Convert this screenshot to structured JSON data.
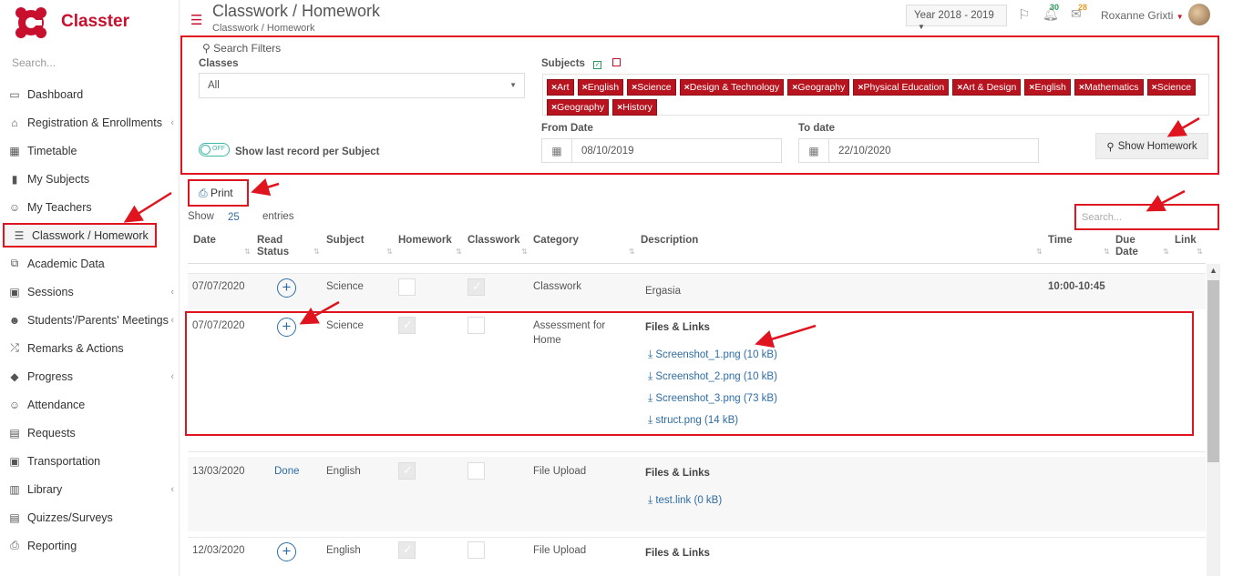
{
  "app": {
    "name": "Classter"
  },
  "sidebar": {
    "search_placeholder": "Search...",
    "items": [
      {
        "label": "Dashboard",
        "icon": "monitor-icon"
      },
      {
        "label": "Registration & Enrollments",
        "icon": "institution-icon",
        "chevron": true
      },
      {
        "label": "Timetable",
        "icon": "calendar-icon"
      },
      {
        "label": "My Subjects",
        "icon": "book-icon"
      },
      {
        "label": "My Teachers",
        "icon": "users-icon"
      },
      {
        "label": "Classwork / Homework",
        "icon": "list-icon",
        "active": true
      },
      {
        "label": "Academic Data",
        "icon": "chart-icon"
      },
      {
        "label": "Sessions",
        "icon": "sessions-icon",
        "chevron": true
      },
      {
        "label": "Students'/Parents' Meetings",
        "icon": "meeting-icon",
        "chevron": true
      },
      {
        "label": "Remarks & Actions",
        "icon": "shuffle-icon"
      },
      {
        "label": "Progress",
        "icon": "graduation-cap-icon",
        "chevron": true
      },
      {
        "label": "Attendance",
        "icon": "user-check-icon"
      },
      {
        "label": "Requests",
        "icon": "document-icon"
      },
      {
        "label": "Transportation",
        "icon": "bus-icon"
      },
      {
        "label": "Library",
        "icon": "library-icon",
        "chevron": true
      },
      {
        "label": "Quizzes/Surveys",
        "icon": "quiz-icon"
      },
      {
        "label": "Reporting",
        "icon": "printer-icon"
      }
    ]
  },
  "header": {
    "title": "Classwork / Homework",
    "breadcrumb": "Classwork / Homework",
    "year": "Year 2018 - 2019",
    "notifications_count": "30",
    "messages_count": "28",
    "user_name": "Roxanne Grixti"
  },
  "filters": {
    "title": "Search Filters",
    "classes_label": "Classes",
    "classes_value": "All",
    "subjects_label": "Subjects",
    "subjects": [
      "Art",
      "English",
      "Science",
      "Design & Technology",
      "Geography",
      "Physical Education",
      "Art & Design",
      "English",
      "Mathematics",
      "Science",
      "Geography",
      "History"
    ],
    "toggle_state": "OFF",
    "toggle_label": "Show last record per Subject",
    "from_date_label": "From Date",
    "from_date": "08/10/2019",
    "to_date_label": "To date",
    "to_date": "22/10/2020",
    "show_button": "Show Homework"
  },
  "table": {
    "print_label": "Print",
    "show_label": "Show",
    "page_size": "25",
    "entries_label": "entries",
    "search_placeholder": "Search...",
    "columns": [
      "Date",
      "Read Status",
      "Subject",
      "Homework",
      "Classwork",
      "Category",
      "Description",
      "Time",
      "Due Date",
      "Link"
    ],
    "files_heading": "Files & Links",
    "rows": [
      {
        "date": "07/07/2020",
        "read": "",
        "subject": "Science",
        "homework": false,
        "classwork": true,
        "category": "Classwork",
        "description": "Ergasia",
        "time": "10:00-10:45",
        "files": []
      },
      {
        "date": "07/07/2020",
        "read": "",
        "subject": "Science",
        "homework": true,
        "classwork": false,
        "category": "Assessment for Home",
        "description": "",
        "time": "",
        "files": [
          "Screenshot_1.png (10 kB)",
          "Screenshot_2.png (10 kB)",
          "Screenshot_3.png (73 kB)",
          "struct.png (14 kB)"
        ]
      },
      {
        "date": "13/03/2020",
        "read": "Done",
        "subject": "English",
        "homework": true,
        "classwork": false,
        "category": "File Upload",
        "description": "",
        "time": "",
        "files": [
          "test.link (0 kB)"
        ]
      },
      {
        "date": "12/03/2020",
        "read": "",
        "subject": "English",
        "homework": true,
        "classwork": false,
        "category": "File Upload",
        "description": "",
        "time": "",
        "files": []
      }
    ]
  },
  "colors": {
    "brand": "#c8102e",
    "annotation": "#e0141e",
    "link": "#2e6da4",
    "tag": "#b8141f"
  }
}
